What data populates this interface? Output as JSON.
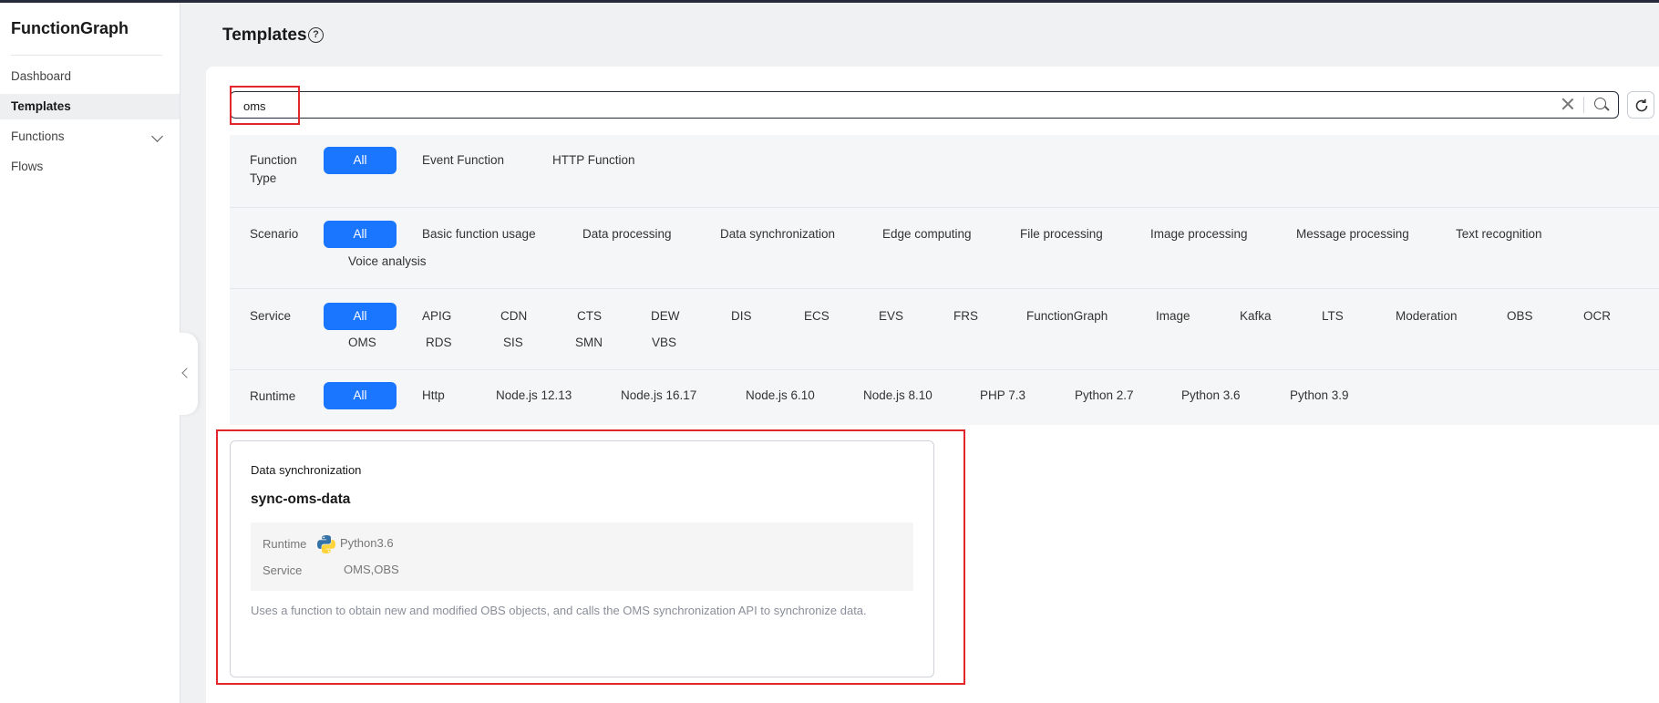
{
  "app": {
    "title": "FunctionGraph"
  },
  "sidebar": {
    "items": [
      {
        "label": "Dashboard"
      },
      {
        "label": "Templates"
      },
      {
        "label": "Functions"
      },
      {
        "label": "Flows"
      }
    ]
  },
  "header": {
    "title": "Templates",
    "help_glyph": "?"
  },
  "search": {
    "value": "oms"
  },
  "filters": {
    "function_type": {
      "label_line1": "Function",
      "label_line2": "Type",
      "options": [
        "All",
        "Event Function",
        "HTTP Function"
      ]
    },
    "scenario": {
      "label": "Scenario",
      "options": [
        "All",
        "Basic function usage",
        "Data processing",
        "Data synchronization",
        "Edge computing",
        "File processing",
        "Image processing",
        "Message processing",
        "Text recognition",
        "Voice analysis"
      ]
    },
    "service": {
      "label": "Service",
      "options": [
        "All",
        "APIG",
        "CDN",
        "CTS",
        "DEW",
        "DIS",
        "ECS",
        "EVS",
        "FRS",
        "FunctionGraph",
        "Image",
        "Kafka",
        "LTS",
        "Moderation",
        "OBS",
        "OCR",
        "OMS",
        "RDS",
        "SIS",
        "SMN",
        "VBS"
      ]
    },
    "runtime": {
      "label": "Runtime",
      "options": [
        "All",
        "Http",
        "Node.js 12.13",
        "Node.js 16.17",
        "Node.js 6.10",
        "Node.js 8.10",
        "PHP 7.3",
        "Python 2.7",
        "Python 3.6",
        "Python 3.9"
      ]
    }
  },
  "card": {
    "category": "Data synchronization",
    "name": "sync-oms-data",
    "runtime_label": "Runtime",
    "runtime_value": "Python3.6",
    "service_label": "Service",
    "service_value": "OMS,OBS",
    "description": "Uses a function to obtain new and modified OBS objects, and calls the OMS synchronization API to synchronize data."
  },
  "colors": {
    "accent": "#1a75ff",
    "highlight": "#e3262b"
  }
}
